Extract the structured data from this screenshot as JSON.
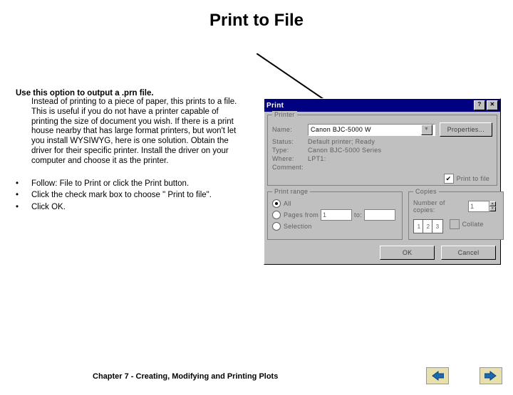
{
  "title": "Print to File",
  "lead": {
    "heading": "Use this option to output a .prn file.",
    "body": "Instead of printing to a piece of paper, this prints to a file. This is useful if you do not have a printer capable of printing the size of document you wish. If there is a print house nearby that has large format printers, but won't let you install WYSIWYG, here is one solution. Obtain the driver for their specific printer. Install the driver on your computer and choose it as the printer."
  },
  "bullets": [
    "Follow: File to Print or click the Print button.",
    "Click the check mark box to choose \" Print to file\".",
    "Click OK."
  ],
  "dialog": {
    "caption": "Print",
    "help_btn": "?",
    "close_btn": "✕",
    "printer_group": "Printer",
    "labels": {
      "name": "Name:",
      "status": "Status:",
      "type": "Type:",
      "where": "Where:",
      "comment": "Comment:"
    },
    "printer_name": "Canon BJC-5000 W",
    "status": "Default printer; Ready",
    "type": "Canon BJC-5000 Series",
    "where": "LPT1:",
    "comment": "",
    "properties": "Properties...",
    "print_to_file": "Print to file",
    "range_group": "Print range",
    "all": "All",
    "pages": "Pages",
    "from": "from",
    "to": "to:",
    "selection": "Selection",
    "from_val": "1",
    "to_val": "",
    "copies_group": "Copies",
    "num_copies": "Number of copies:",
    "copies_val": "1",
    "collate": "Collate",
    "page_icons": [
      "1",
      "2",
      "3"
    ],
    "ok": "OK",
    "cancel": "Cancel"
  },
  "footer": "Chapter 7 - Creating, Modifying and Printing Plots",
  "nav": {
    "prev": "prev",
    "next": "next"
  }
}
